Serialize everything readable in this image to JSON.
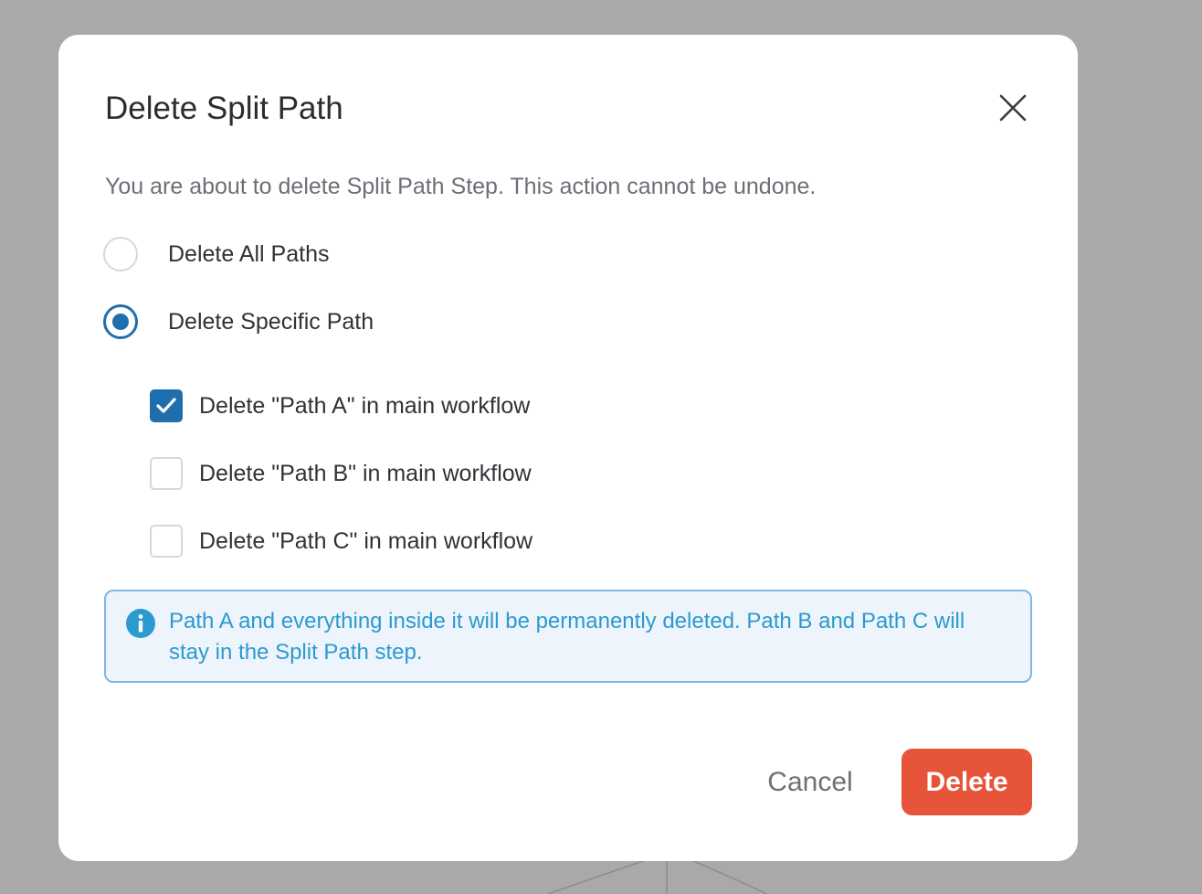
{
  "dialog": {
    "title": "Delete Split Path",
    "description": "You are about to delete Split Path Step. This action cannot be undone."
  },
  "options": [
    {
      "label": "Delete All Paths",
      "selected": false
    },
    {
      "label": "Delete Specific Path",
      "selected": true
    }
  ],
  "paths": [
    {
      "label": "Delete \"Path A\" in main workflow",
      "checked": true
    },
    {
      "label": "Delete \"Path B\" in main workflow",
      "checked": false
    },
    {
      "label": "Delete \"Path C\" in main workflow",
      "checked": false
    }
  ],
  "info": {
    "icon": "info-icon",
    "text": "Path A and everything inside it will be permanently deleted. Path B and Path C will stay in the Split Path step."
  },
  "actions": {
    "cancel_label": "Cancel",
    "delete_label": "Delete"
  },
  "colors": {
    "accent": "#1f6fae",
    "danger": "#e6553a",
    "info_text": "#2b9ad0",
    "info_border": "#7fb8e0",
    "info_bg": "#eef4fb"
  }
}
